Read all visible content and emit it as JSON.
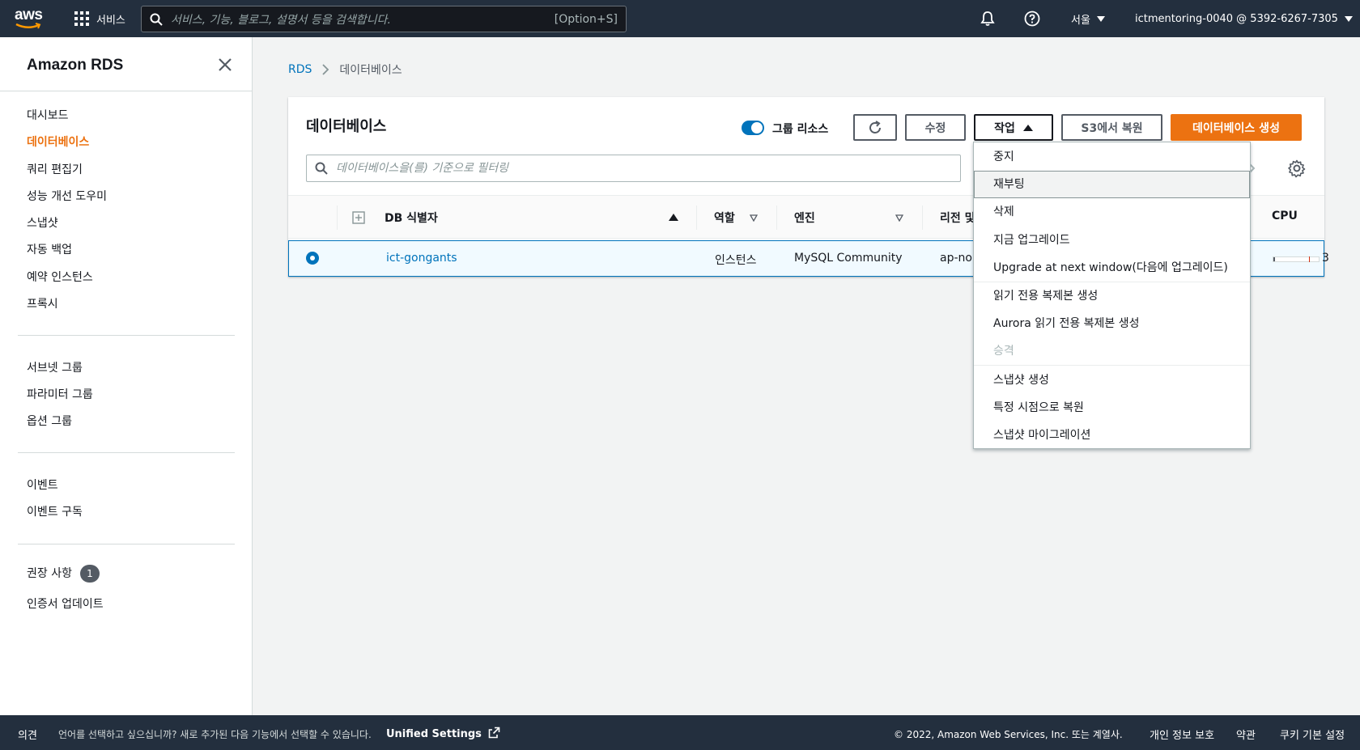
{
  "topnav": {
    "logo_text": "aws",
    "services_label": "서비스",
    "search_placeholder": "서비스, 기능, 블로그, 설명서 등을 검색합니다.",
    "search_shortcut": "[Option+S]",
    "region": "서울",
    "account": "ictmentoring-0040 @ 5392-6267-7305"
  },
  "sidebar": {
    "title": "Amazon RDS",
    "group1": [
      "대시보드",
      "데이터베이스",
      "쿼리 편집기",
      "성능 개선 도우미",
      "스냅샷",
      "자동 백업",
      "예약 인스턴스",
      "프록시"
    ],
    "active_item": "데이터베이스",
    "group2": [
      "서브넷 그룹",
      "파라미터 그룹",
      "옵션 그룹"
    ],
    "group3": [
      "이벤트",
      "이벤트 구독"
    ],
    "group4": {
      "recommendations_label": "권장 사항",
      "recommendations_count": "1",
      "cert_update": "인증서 업데이트"
    }
  },
  "breadcrumb": {
    "root": "RDS",
    "current": "데이터베이스"
  },
  "panel": {
    "title": "데이터베이스",
    "group_resources_label": "그룹 리소스",
    "group_resources_on": true,
    "buttons": {
      "modify": "수정",
      "actions": "작업",
      "restore_s3": "S3에서 복원",
      "create_db": "데이터베이스 생성"
    },
    "filter_placeholder": "데이터베이스을(를) 기준으로 필터링"
  },
  "table": {
    "columns": {
      "db_identifier": "DB 식별자",
      "role": "역할",
      "engine": "엔진",
      "region": "리전 및",
      "cpu": "CPU"
    },
    "rows": [
      {
        "db_identifier": "ict-gongants",
        "role": "인스턴스",
        "engine": "MySQL Community",
        "region": "ap-no",
        "cpu_level": 0.04,
        "cpu_text": "3",
        "selected": true
      }
    ]
  },
  "actions_menu": {
    "items": [
      {
        "label": "중지",
        "disabled": false
      },
      {
        "label": "재부팅",
        "disabled": false,
        "highlighted": true
      },
      {
        "label": "삭제",
        "disabled": false
      },
      {
        "label": "지금 업그레이드",
        "disabled": false
      },
      {
        "label": "Upgrade at next window(다음에 업그레이드)",
        "disabled": false
      },
      {
        "label": "읽기 전용 복제본 생성",
        "disabled": false
      },
      {
        "label": "Aurora 읽기 전용 복제본 생성",
        "disabled": false
      },
      {
        "label": "승격",
        "disabled": true
      },
      {
        "label": "스냅샷 생성",
        "disabled": false
      },
      {
        "label": "특정 시점으로 복원",
        "disabled": false
      },
      {
        "label": "스냅샷 마이그레이션",
        "disabled": false
      }
    ]
  },
  "footer": {
    "feedback": "의견",
    "language_prompt": "언어를 선택하고 싶으십니까? 새로 추가된 다음 기능에서 선택할 수 있습니다.",
    "unified_settings": "Unified Settings",
    "copyright": "© 2022, Amazon Web Services, Inc. 또는 계열사.",
    "privacy": "개인 정보 보호",
    "terms": "약관",
    "cookie": "쿠키 기본 설정"
  },
  "colors": {
    "nav_bg": "#232f3e",
    "accent_orange": "#ec7211",
    "link_blue": "#0073bb",
    "page_bg": "#f2f3f3"
  }
}
